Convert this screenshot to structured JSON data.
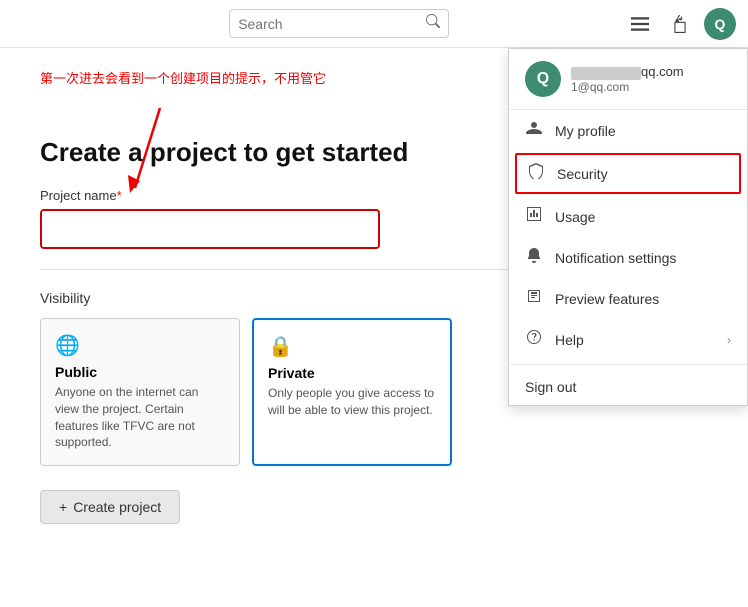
{
  "header": {
    "search_placeholder": "Search",
    "avatar_letter": "Q"
  },
  "user": {
    "email_suffix": "qq.com",
    "email_sub": "1@qq.com",
    "avatar_letter": "Q"
  },
  "dropdown": {
    "my_profile": "My profile",
    "security": "Security",
    "usage": "Usage",
    "notification_settings": "Notification settings",
    "preview_features": "Preview features",
    "help": "Help",
    "sign_out": "Sign out"
  },
  "main": {
    "annotation_text": "第一次进去会看到一个创建项目的提示，不用管它",
    "page_title": "Create a project to get started",
    "field_label": "Project name",
    "field_required": "*",
    "visibility_label": "Visibility",
    "public_title": "Public",
    "public_desc": "Anyone on the internet can view the project. Certain features like TFVC are not supported.",
    "private_title": "Private",
    "private_desc": "Only people you give access to will be able to view this project.",
    "create_button": "Create project"
  }
}
